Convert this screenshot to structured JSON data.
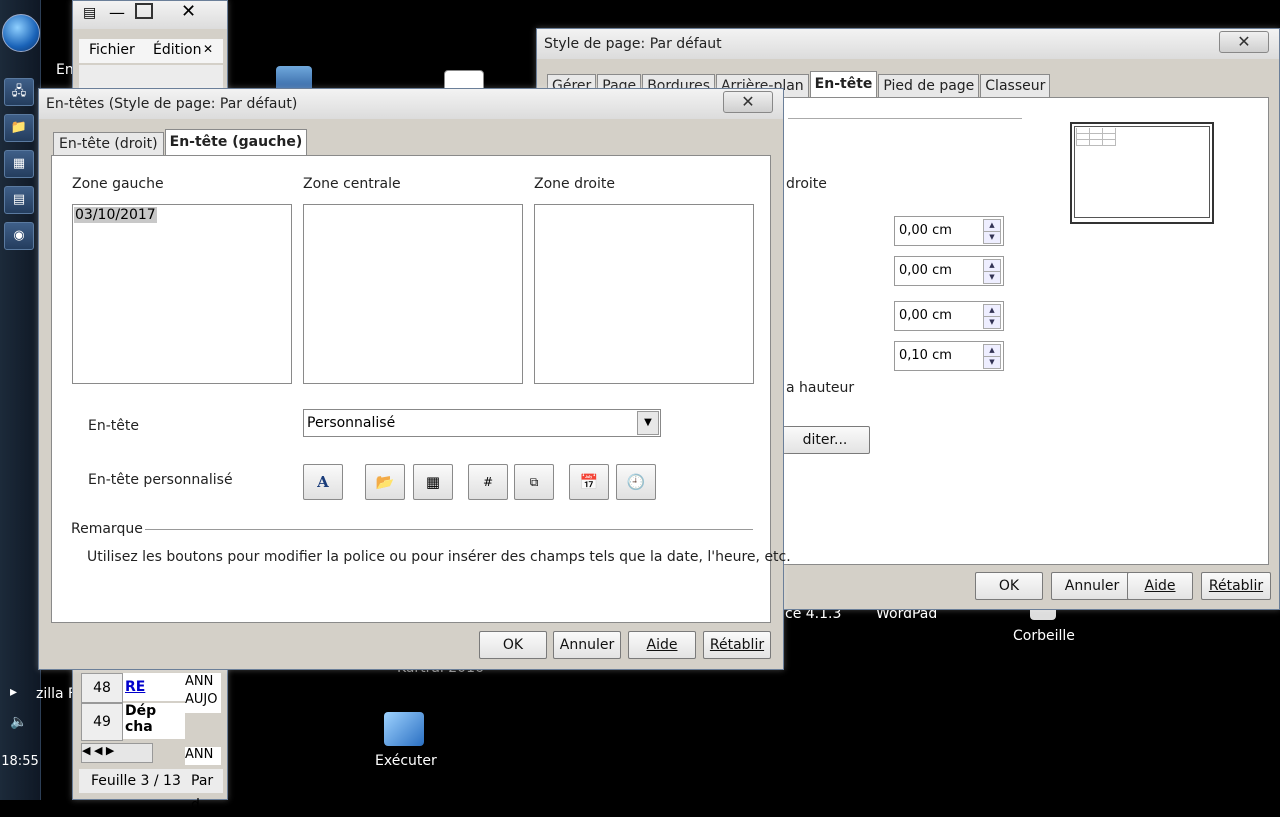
{
  "taskbar": {
    "clock": "18:55"
  },
  "desktop": {
    "labels": {
      "en_partial": "En",
      "zilla": "zilla F",
      "nfa": "ce 4.1.3",
      "wordpad": "WordPad",
      "corbeille": "Corbeille",
      "executer": "Exécuter",
      "kurtral": "Kurtral 2016"
    }
  },
  "calc": {
    "menu_fichier": "Fichier",
    "menu_edition": "Édition",
    "row48": "48",
    "row49": "49",
    "cell48b": "RE",
    "cell49b_1": "Dép",
    "cell49b_2": "cha",
    "col_c1": "ANN",
    "col_c2": "AUJO",
    "col_c3": "ANN",
    "sheet_status": "Feuille 3 / 13",
    "status2": "Par d"
  },
  "pagestyle": {
    "title": "Style de page: Par défaut",
    "tabs": [
      "Gérer",
      "Page",
      "Bordures",
      "Arrière-plan",
      "En-tête",
      "Pied de page",
      "Classeur"
    ],
    "partial_droite": "droite",
    "spin1": "0,00 cm",
    "spin2": "0,00 cm",
    "spin3": "0,00 cm",
    "spin4": "0,10 cm",
    "partial_hauteur": "a hauteur",
    "edit_btn": "diter...",
    "ok": "OK",
    "annuler": "Annuler",
    "aide": "Aide",
    "retablir": "Rétablir"
  },
  "headers_dialog": {
    "title": "En-têtes (Style de page: Par défaut)",
    "tab_right": "En-tête (droit)",
    "tab_left": "En-tête (gauche)",
    "zone_left_label": "Zone gauche",
    "zone_center_label": "Zone centrale",
    "zone_right_label": "Zone droite",
    "zone_left_content": "03/10/2017",
    "header_label": "En-tête",
    "header_select": "Personnalisé",
    "custom_label": "En-tête personnalisé",
    "remark_title": "Remarque",
    "remark_text": "Utilisez les boutons pour modifier la police ou pour insérer des champs tels que la date, l'heure, etc.",
    "ok": "OK",
    "annuler": "Annuler",
    "aide": "Aide",
    "retablir": "Rétablir"
  }
}
